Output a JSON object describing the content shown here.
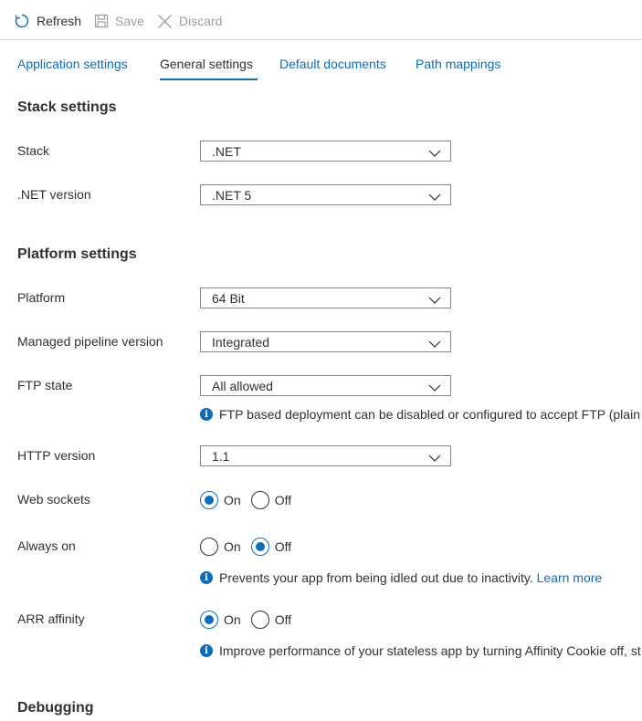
{
  "toolbar": {
    "refresh_label": "Refresh",
    "save_label": "Save",
    "discard_label": "Discard"
  },
  "tabs": [
    {
      "label": "Application settings",
      "active": false
    },
    {
      "label": "General settings",
      "active": true
    },
    {
      "label": "Default documents",
      "active": false
    },
    {
      "label": "Path mappings",
      "active": false
    }
  ],
  "stack_settings": {
    "title": "Stack settings",
    "stack": {
      "label": "Stack",
      "value": ".NET"
    },
    "net_version": {
      "label": ".NET version",
      "value": ".NET 5"
    }
  },
  "platform_settings": {
    "title": "Platform settings",
    "platform": {
      "label": "Platform",
      "value": "64 Bit"
    },
    "pipeline": {
      "label": "Managed pipeline version",
      "value": "Integrated"
    },
    "ftp": {
      "label": "FTP state",
      "value": "All allowed",
      "info": "FTP based deployment can be disabled or configured to accept FTP (plain te"
    },
    "http": {
      "label": "HTTP version",
      "value": "1.1"
    },
    "web_sockets": {
      "label": "Web sockets",
      "on_label": "On",
      "off_label": "Off",
      "selected": "On"
    },
    "always_on": {
      "label": "Always on",
      "on_label": "On",
      "off_label": "Off",
      "selected": "Off",
      "info": "Prevents your app from being idled out due to inactivity.",
      "link": "Learn more"
    },
    "arr_affinity": {
      "label": "ARR affinity",
      "on_label": "On",
      "off_label": "Off",
      "selected": "On",
      "info": "Improve performance of your stateless app by turning Affinity Cookie off, st"
    }
  },
  "debugging": {
    "title": "Debugging"
  },
  "colors": {
    "accent": "#0f6cbd",
    "text": "#323130",
    "disabled": "#a19f9d",
    "border": "#8a8886"
  },
  "icons": {
    "refresh": "refresh-icon",
    "save": "save-icon",
    "discard": "discard-icon",
    "chevron": "chevron-down-icon",
    "info": "info-icon"
  }
}
